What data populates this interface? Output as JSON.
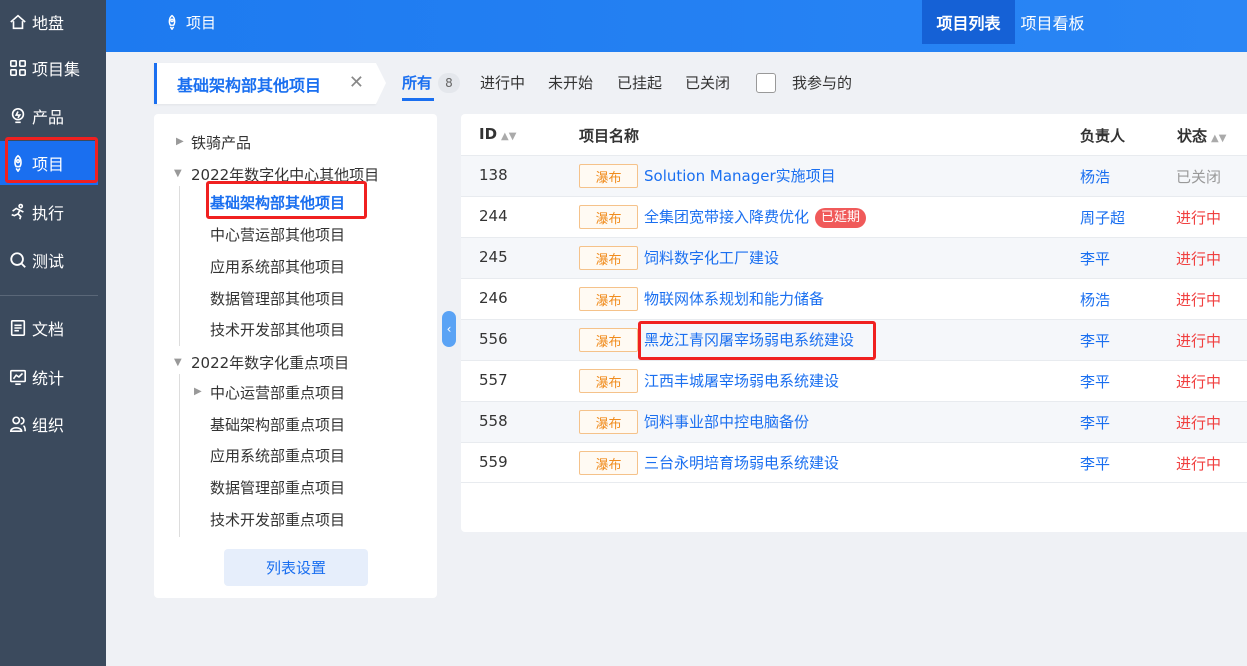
{
  "sidebar": {
    "items": [
      {
        "label": "地盘",
        "icon": "home-icon"
      },
      {
        "label": "项目集",
        "icon": "grid-icon"
      },
      {
        "label": "产品",
        "icon": "bulb-icon"
      },
      {
        "label": "项目",
        "icon": "rocket-icon"
      },
      {
        "label": "执行",
        "icon": "run-icon"
      },
      {
        "label": "测试",
        "icon": "search-icon"
      },
      {
        "label": "文档",
        "icon": "doc-icon"
      },
      {
        "label": "统计",
        "icon": "chart-icon"
      },
      {
        "label": "组织",
        "icon": "people-icon"
      }
    ],
    "active_index": 3
  },
  "header": {
    "breadcrumb": "项目",
    "tabs": [
      "项目列表",
      "项目看板"
    ]
  },
  "filter": {
    "program": "基础架构部其他项目",
    "tabs": [
      "所有",
      "进行中",
      "未开始",
      "已挂起",
      "已关闭"
    ],
    "all_count": "8",
    "involved_label": "我参与的"
  },
  "tree": {
    "items": [
      {
        "label": "铁骑产品"
      },
      {
        "label": "2022年数字化中心其他项目"
      },
      {
        "label": "基础架构部其他项目"
      },
      {
        "label": "中心营运部其他项目"
      },
      {
        "label": "应用系统部其他项目"
      },
      {
        "label": "数据管理部其他项目"
      },
      {
        "label": "技术开发部其他项目"
      },
      {
        "label": "2022年数字化重点项目"
      },
      {
        "label": "中心运营部重点项目"
      },
      {
        "label": "基础架构部重点项目"
      },
      {
        "label": "应用系统部重点项目"
      },
      {
        "label": "数据管理部重点项目"
      },
      {
        "label": "技术开发部重点项目"
      }
    ],
    "list_settings": "列表设置"
  },
  "table": {
    "columns": {
      "id": "ID",
      "name": "项目名称",
      "owner": "负责人",
      "status": "状态"
    },
    "rows": [
      {
        "id": "138",
        "type": "瀑布",
        "name": "Solution Manager实施项目",
        "badge": "",
        "owner": "杨浩",
        "status": "已关闭"
      },
      {
        "id": "244",
        "type": "瀑布",
        "name": "全集团宽带接入降费优化",
        "badge": "已延期",
        "owner": "周子超",
        "status": "进行中"
      },
      {
        "id": "245",
        "type": "瀑布",
        "name": "饲料数字化工厂建设",
        "badge": "",
        "owner": "李平",
        "status": "进行中"
      },
      {
        "id": "246",
        "type": "瀑布",
        "name": "物联网体系规划和能力储备",
        "badge": "",
        "owner": "杨浩",
        "status": "进行中"
      },
      {
        "id": "556",
        "type": "瀑布",
        "name": "黑龙江青冈屠宰场弱电系统建设",
        "badge": "",
        "owner": "李平",
        "status": "进行中"
      },
      {
        "id": "557",
        "type": "瀑布",
        "name": "江西丰城屠宰场弱电系统建设",
        "badge": "",
        "owner": "李平",
        "status": "进行中"
      },
      {
        "id": "558",
        "type": "瀑布",
        "name": "饲料事业部中控电脑备份",
        "badge": "",
        "owner": "李平",
        "status": "进行中"
      },
      {
        "id": "559",
        "type": "瀑布",
        "name": "三台永明培育场弱电系统建设",
        "badge": "",
        "owner": "李平",
        "status": "进行中"
      }
    ]
  }
}
